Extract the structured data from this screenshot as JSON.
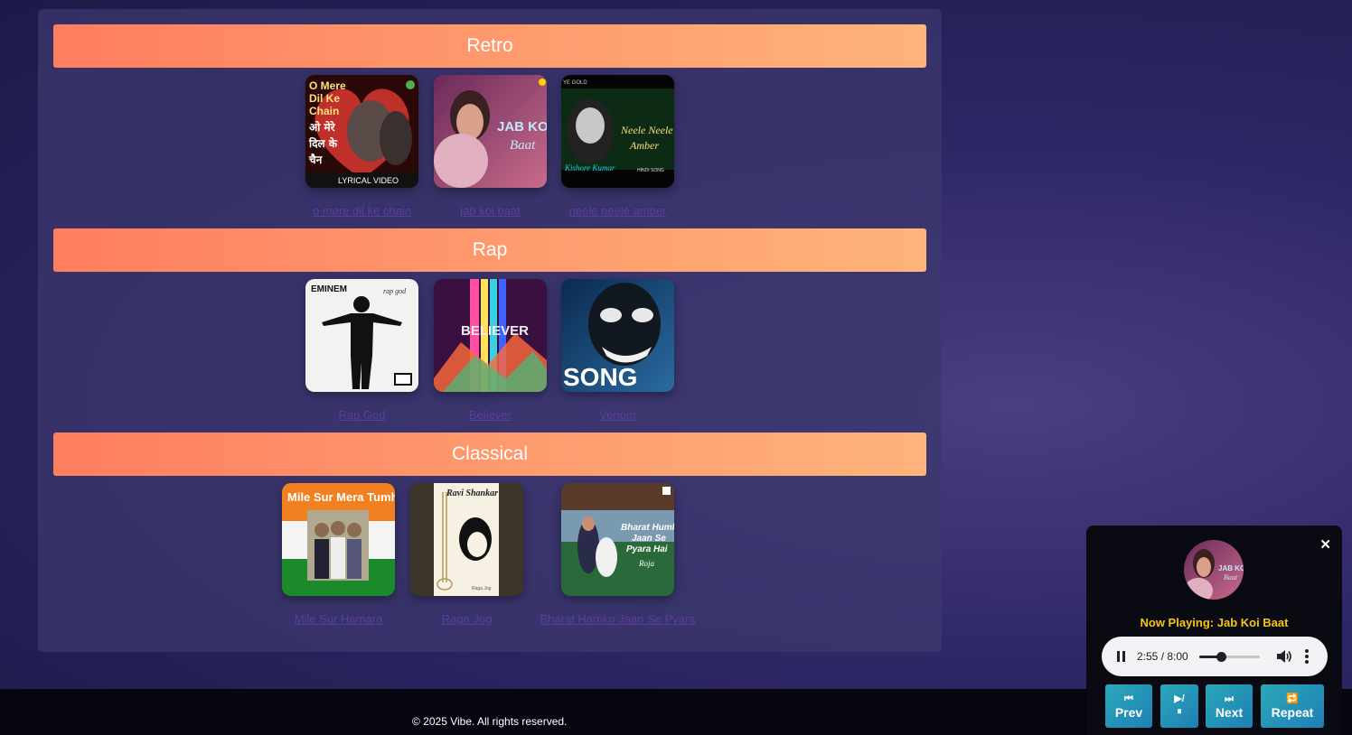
{
  "sections": [
    {
      "title": "Retro",
      "songs": [
        {
          "title": "o mere dil ke chain",
          "cover_icon": "o-mere-dil-ke-chain-cover"
        },
        {
          "title": "jab koi baat",
          "cover_icon": "jab-koi-baat-cover"
        },
        {
          "title": "neele neele amber",
          "cover_icon": "neele-neele-amber-cover"
        }
      ]
    },
    {
      "title": "Rap",
      "songs": [
        {
          "title": "Rap God",
          "cover_icon": "rap-god-cover"
        },
        {
          "title": "Believer",
          "cover_icon": "believer-cover"
        },
        {
          "title": "Venom",
          "cover_icon": "venom-cover"
        }
      ]
    },
    {
      "title": "Classical",
      "songs": [
        {
          "title": "Mile Sur Hamara",
          "cover_icon": "mile-sur-cover"
        },
        {
          "title": "Raga Jog",
          "cover_icon": "raga-jog-cover"
        },
        {
          "title": "Bharat Hamko Jaan Se Pyara",
          "cover_icon": "bharat-humko-cover"
        }
      ]
    }
  ],
  "cover_text": {
    "o_mere": [
      "O Mere",
      "Dil Ke",
      "Chain",
      "ओ मेरे",
      "दिल के",
      "चैन",
      "LYRICAL VIDEO"
    ],
    "jab_koi": [
      "JAB KOI",
      "Baat"
    ],
    "neele": [
      "Neele Neele",
      "Amber",
      "Kishore Kumar",
      "HINDI SONG",
      "YE GOLD"
    ],
    "rap_god": [
      "EMINEM",
      "rap god"
    ],
    "believer": [
      "BELIEVER"
    ],
    "venom": [
      "SONG"
    ],
    "mile_sur": [
      "Mile Sur Mera Tumhara"
    ],
    "raga_jog": [
      "Ravi Shankar",
      "Raga Jog"
    ],
    "bharat": [
      "Bharat Humko",
      "Jaan Se",
      "Pyara Hai",
      "Roja"
    ]
  },
  "footer": {
    "copyright": "© 2025 Vibe. All rights reserved."
  },
  "player": {
    "close_label": "✕",
    "now_playing": "Now Playing: Jab Koi Baat",
    "time": "2:55 / 8:00",
    "progress_fraction": 0.365,
    "buttons": {
      "prev_icon": "⏮",
      "prev": "Prev",
      "playpause_icon": "▶/",
      "playpause_icon2": "⏸",
      "next_icon": "⏭",
      "next": "Next",
      "repeat_icon": "🔁",
      "repeat": "Repeat"
    }
  },
  "colors": {
    "header_gradient_start": "#ff7e5f",
    "header_gradient_end": "#feb47b",
    "now_playing": "#f5c518",
    "link": "#5a3e9c",
    "button_gradient": "#2aa8b8"
  }
}
